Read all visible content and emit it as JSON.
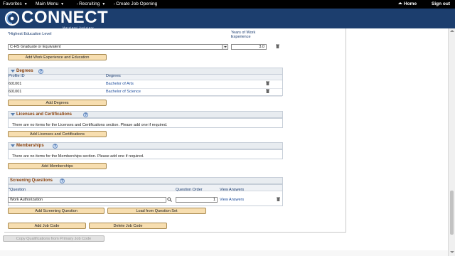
{
  "menu": {
    "items": [
      "Favorites",
      "Main Menu",
      "Recruiting",
      "Create Job Opening"
    ],
    "home": "Home",
    "signout": "Sign out"
  },
  "brand": {
    "name": "CONNECT",
    "subtitle": "Maryland Judiciary"
  },
  "education": {
    "level_label": "*Highest Education Level",
    "years_label_1": "Years of Work",
    "years_label_2": "Experience",
    "level_value": "C-HS Graduate or Equivalent",
    "years_value": "3.0",
    "add_button": "Add Work Experience and Education"
  },
  "degrees": {
    "title": "Degrees",
    "col_profile": "Profile ID",
    "col_degree": "Degrees",
    "rows": [
      {
        "profile_id": "601001",
        "degree": "Bachelor of Arts"
      },
      {
        "profile_id": "601001",
        "degree": "Bachelor of Science"
      }
    ],
    "add_button": "Add Degrees"
  },
  "licenses": {
    "title": "Licenses and Certifications",
    "empty_text": "There are no items for the Licenses and Certifications section.  Please add one if required.",
    "add_button": "Add Licenses and Certifications"
  },
  "memberships": {
    "title": "Memberships",
    "empty_text": "There are no items for the Memberships section.  Please add one if required.",
    "add_button": "Add Memberships"
  },
  "screening": {
    "title": "Screening Questions",
    "col_question": "*Question",
    "col_order": "Question Order",
    "col_view": "View Answers",
    "question_value": "Work Authorization",
    "order_value": "1",
    "view_link": "View Answers",
    "add_button": "Add Screening Question",
    "load_button": "Load from Question Set"
  },
  "job_code": {
    "add_button": "Add Job Code",
    "delete_button": "Delete Job Code"
  },
  "copy_button": "Copy Qualifications from Primary Job Code",
  "colors": {
    "menu_bar": "#000000",
    "brand_bar": "#1c3e6e",
    "button": "#f7deb0",
    "section_title": "#8a3f08",
    "link": "#1a4a9a"
  }
}
